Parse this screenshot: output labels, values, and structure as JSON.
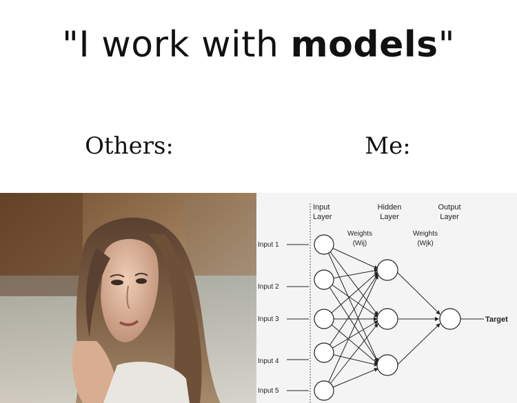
{
  "caption": {
    "quote_open": "\"I work with ",
    "emphasis": "models",
    "quote_close": "\""
  },
  "labels": {
    "others": "Others:",
    "me": "Me:"
  },
  "diagram": {
    "layer_titles": {
      "input": [
        "Input",
        "Layer"
      ],
      "hidden": [
        "Hidden",
        "Layer"
      ],
      "output": [
        "Output",
        "Layer"
      ]
    },
    "weights": [
      {
        "label": "Weights",
        "symbol": "(Wij)"
      },
      {
        "label": "Weights",
        "symbol": "(Wjk)"
      }
    ],
    "inputs": [
      "Input 1",
      "Input 2",
      "Input 3",
      "Input 4",
      "Input 5"
    ],
    "target": "Target"
  },
  "colors": {
    "background": "#ffffff",
    "text": "#111111",
    "diagram_bg": "#f4f4f4",
    "diagram_stroke": "#222222"
  }
}
